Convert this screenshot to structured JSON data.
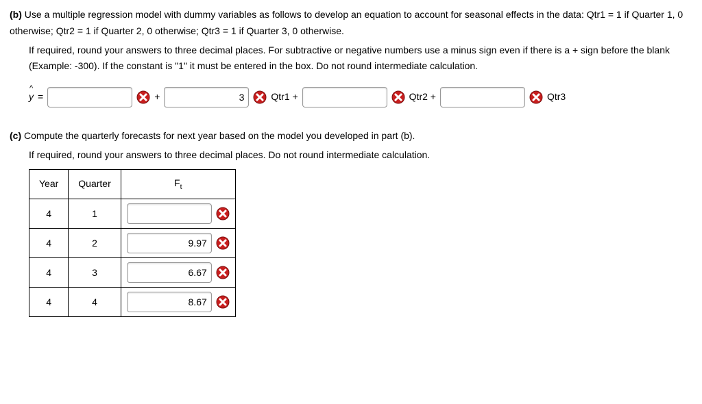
{
  "partB": {
    "label": "(b)",
    "para1": "Use a multiple regression model with dummy variables as follows to develop an equation to account for seasonal effects in the data: Qtr1 = 1 if Quarter 1, 0 otherwise; Qtr2 = 1 if Quarter 2, 0 otherwise; Qtr3 = 1 if Quarter 3, 0 otherwise.",
    "para2": "If required, round your answers to three decimal places. For subtractive or negative numbers use a minus sign even if there is a + sign before the blank (Example: -300). If the constant is \"1\" it must be entered in the box. Do not round intermediate calculation.",
    "equation": {
      "yhat": "ŷ",
      "equals": "=",
      "b0_value": "",
      "plus1": "+",
      "b1_value": "3",
      "term1": "Qtr1 +",
      "b2_value": "",
      "term2": "Qtr2 +",
      "b3_value": "",
      "term3": "Qtr3"
    }
  },
  "partC": {
    "label": "(c)",
    "para1": "Compute the quarterly forecasts for next year based on the model you developed in part (b).",
    "para2": "If required, round your answers to three decimal places. Do not round intermediate calculation.",
    "table": {
      "headers": {
        "year": "Year",
        "quarter": "Quarter",
        "ft": "Ft"
      },
      "rows": [
        {
          "year": "4",
          "quarter": "1",
          "ft": ""
        },
        {
          "year": "4",
          "quarter": "2",
          "ft": "9.97"
        },
        {
          "year": "4",
          "quarter": "3",
          "ft": "6.67"
        },
        {
          "year": "4",
          "quarter": "4",
          "ft": "8.67"
        }
      ]
    }
  }
}
